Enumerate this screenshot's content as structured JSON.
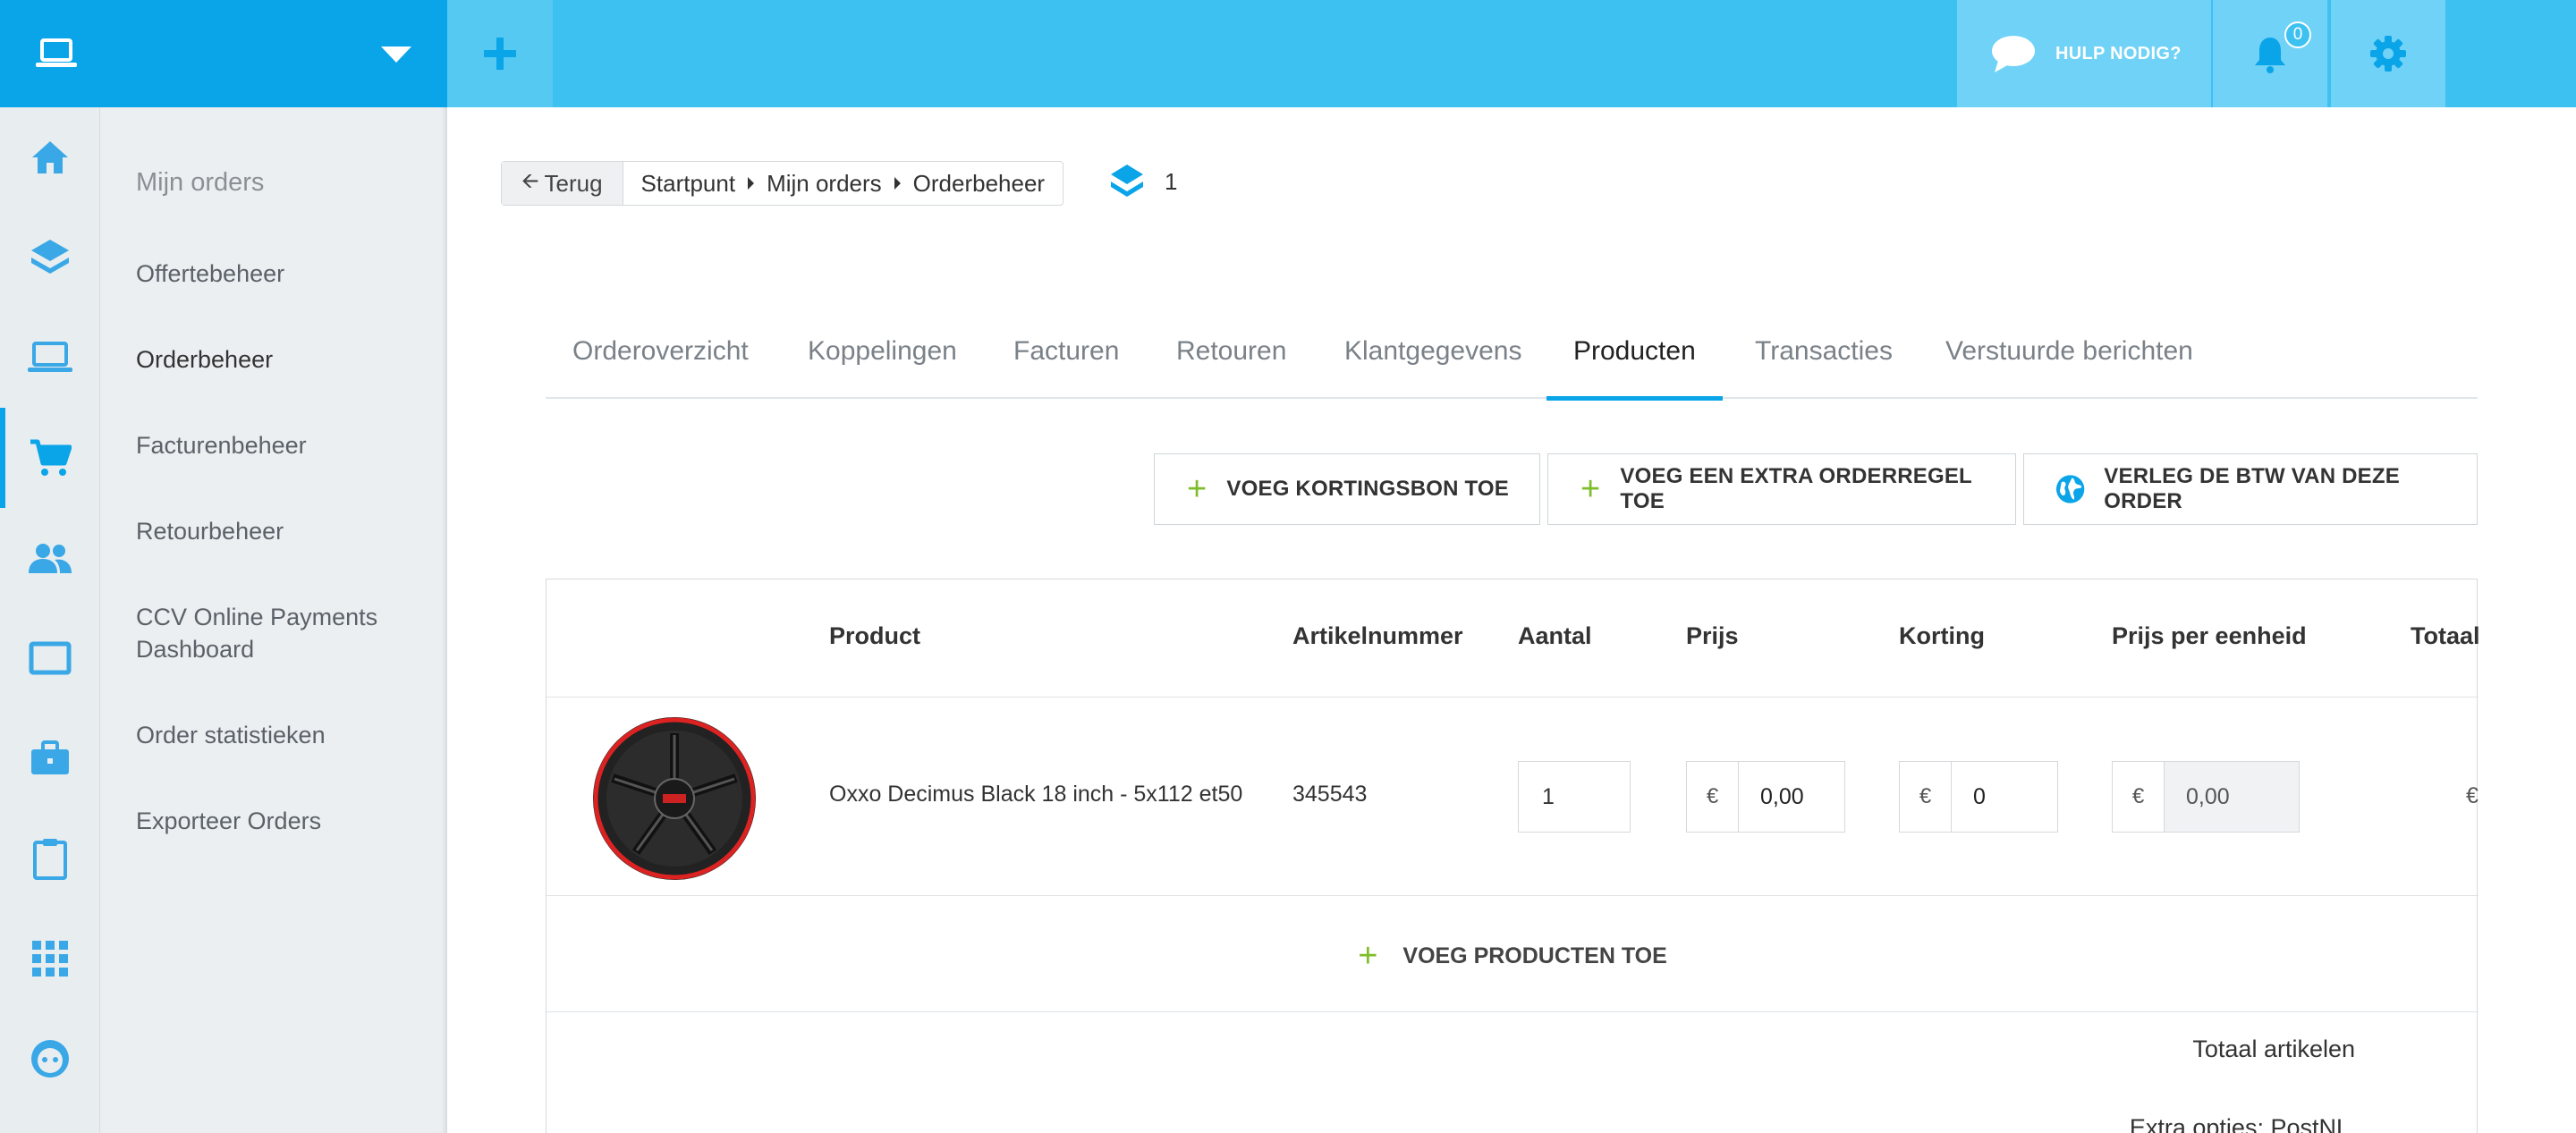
{
  "topbar": {
    "help_label": "HULP NODIG?",
    "notification_count": "0",
    "colors": {
      "bar": "#3dc1f1",
      "left": "#0aa4e8"
    }
  },
  "rail": {
    "icons": [
      "home-icon",
      "layers-icon",
      "laptop-icon",
      "cart-icon",
      "users-icon",
      "screen-icon",
      "briefcase-icon",
      "clipboard-icon",
      "grid-icon",
      "face-icon"
    ],
    "active": "cart-icon"
  },
  "submenu": {
    "title": "Mijn orders",
    "items": [
      "Offertebeheer",
      "Orderbeheer",
      "Facturenbeheer",
      "Retourbeheer",
      "CCV Online Payments Dashboard",
      "Order statistieken",
      "Exporteer Orders"
    ]
  },
  "breadcrumb": {
    "back": "Terug",
    "items": [
      "Startpunt",
      "Mijn orders",
      "Orderbeheer"
    ],
    "layer_count": "1"
  },
  "tabs": [
    "Orderoverzicht",
    "Koppelingen",
    "Facturen",
    "Retouren",
    "Klantgegevens",
    "Producten",
    "Transacties",
    "Verstuurde berichten"
  ],
  "active_tab": "Producten",
  "actions": {
    "coupon": "VOEG KORTINGSBON TOE",
    "extra_line": "VOEG EEN EXTRA ORDERREGEL TOE",
    "vat": "VERLEG DE BTW VAN DEZE ORDER"
  },
  "table": {
    "headers": [
      "Product",
      "Artikelnummer",
      "Aantal",
      "Prijs",
      "Korting",
      "Prijs per eenheid",
      "Totaal"
    ],
    "row": {
      "product": "Oxxo Decimus Black 18 inch - 5x112 et50",
      "sku": "345543",
      "quantity": "1",
      "currency": "€",
      "price": "0,00",
      "discount": "0",
      "unit_price": "0,00",
      "total_currency": "€"
    },
    "add_products": "VOEG PRODUCTEN TOE",
    "total_items_label": "Totaal artikelen",
    "extra_options_label": "Extra opties: PostNL"
  }
}
